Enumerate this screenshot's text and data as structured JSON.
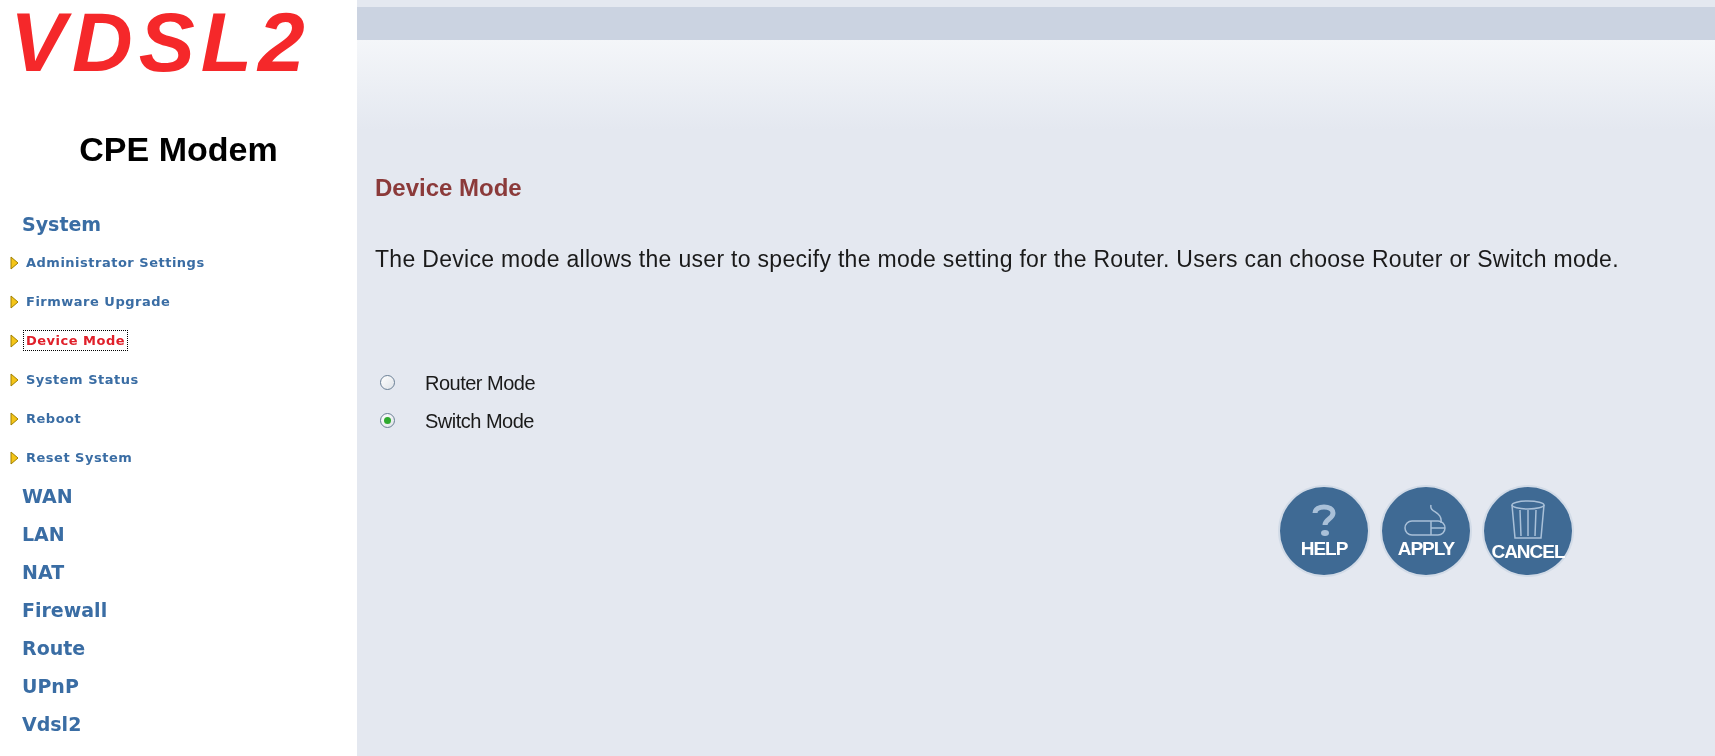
{
  "logo": "VDSL2",
  "product": "CPE Modem",
  "sidebar": {
    "items": [
      {
        "label": "System",
        "selected": false,
        "children": [
          {
            "label": "Administrator Settings",
            "selected": false
          },
          {
            "label": "Firmware Upgrade",
            "selected": false
          },
          {
            "label": "Device Mode",
            "selected": true
          },
          {
            "label": "System Status",
            "selected": false
          },
          {
            "label": "Reboot",
            "selected": false
          },
          {
            "label": "Reset System",
            "selected": false
          }
        ]
      },
      {
        "label": "WAN",
        "selected": false
      },
      {
        "label": "LAN",
        "selected": false
      },
      {
        "label": "NAT",
        "selected": false
      },
      {
        "label": "Firewall",
        "selected": false
      },
      {
        "label": "Route",
        "selected": false
      },
      {
        "label": "UPnP",
        "selected": false
      },
      {
        "label": "Vdsl2",
        "selected": false
      }
    ]
  },
  "page": {
    "title": "Device Mode",
    "description": "The Device mode allows the user to specify the mode setting for the Router. Users can choose Router or Switch mode.",
    "options": [
      {
        "label": "Router Mode",
        "selected": false
      },
      {
        "label": "Switch Mode",
        "selected": true
      }
    ],
    "buttons": [
      {
        "kind": "help",
        "label": "HELP"
      },
      {
        "kind": "apply",
        "label": "APPLY"
      },
      {
        "kind": "cancel",
        "label": "CANCEL"
      }
    ]
  }
}
